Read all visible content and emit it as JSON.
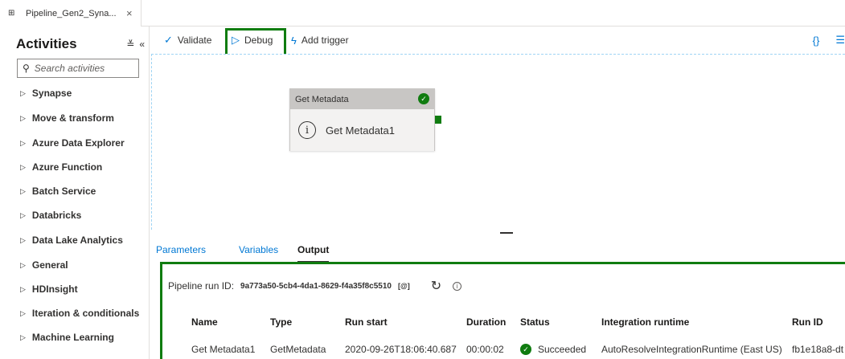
{
  "tab": {
    "title": "Pipeline_Gen2_Syna...",
    "icon": "pipeline-icon",
    "close": "×"
  },
  "activities_panel": {
    "title": "Activities",
    "search_placeholder": "Search activities",
    "categories": [
      "Synapse",
      "Move & transform",
      "Azure Data Explorer",
      "Azure Function",
      "Batch Service",
      "Databricks",
      "Data Lake Analytics",
      "General",
      "HDInsight",
      "Iteration & conditionals",
      "Machine Learning"
    ]
  },
  "toolbar": {
    "validate_label": "Validate",
    "debug_label": "Debug",
    "add_trigger_label": "Add trigger"
  },
  "canvas": {
    "activity": {
      "type_label": "Get Metadata",
      "name": "Get Metadata1"
    }
  },
  "bottom_panel": {
    "tabs": [
      "Parameters",
      "Variables",
      "Output"
    ],
    "active_tab": "Output",
    "run_id_label": "Pipeline run ID:",
    "run_id_value": "9a773a50-5cb4-4da1-8629-f4a35f8c5510",
    "table": {
      "columns": [
        "Name",
        "Type",
        "Run start",
        "Duration",
        "Status",
        "Integration runtime",
        "Run ID"
      ],
      "rows": [
        [
          "Get Metadata1",
          "GetMetadata",
          "2020-09-26T18:06:40.687",
          "00:00:02",
          "Succeeded",
          "AutoResolveIntegrationRuntime (East US)",
          "fb1e18a8-dt"
        ]
      ]
    }
  },
  "colors": {
    "accent": "#0078d4",
    "highlight": "#107c10",
    "success": "#107c10"
  }
}
